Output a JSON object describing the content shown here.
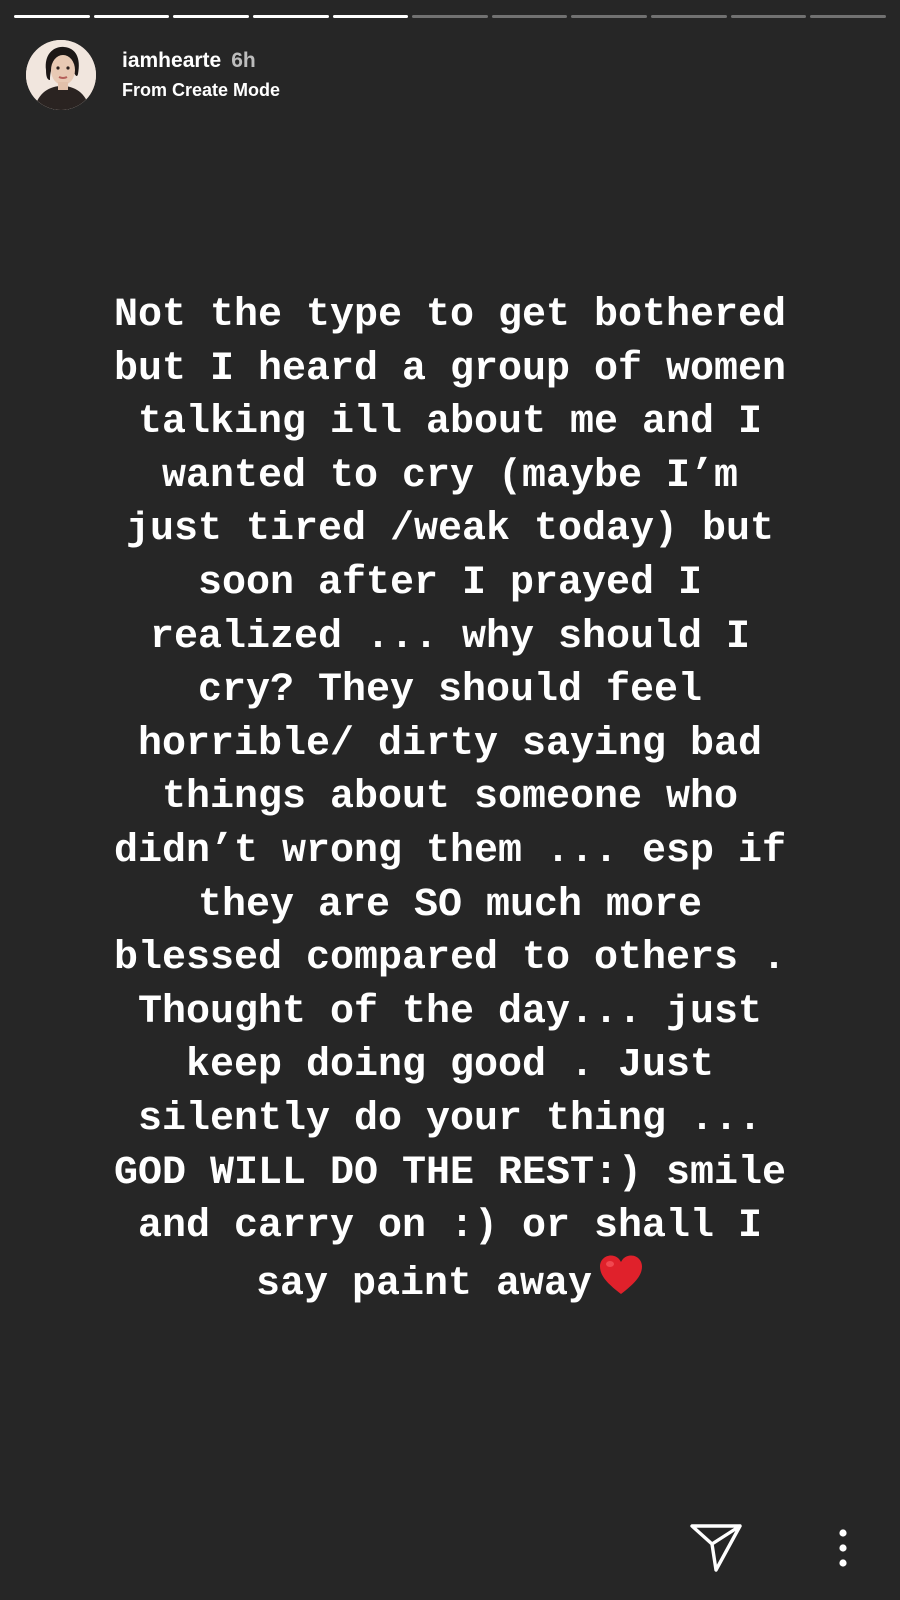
{
  "progress": {
    "total_segments": 11,
    "completed_segments": 5
  },
  "header": {
    "username": "iamhearte",
    "time": "6h",
    "subtitle": "From Create Mode"
  },
  "story": {
    "lines": [
      "Not the type to get bothered",
      "but I heard a group of women",
      "talking ill about me and I",
      "wanted to cry (maybe I’m",
      "just tired /weak today) but",
      "soon after I prayed I",
      "realized ... why should I",
      "cry? They should feel",
      "horrible/ dirty saying bad",
      "things about someone who",
      "didn’t wrong them ... esp if",
      "they are SO much more",
      "blessed compared to others .",
      "Thought of the day... just",
      "keep doing good . Just",
      "silently do your thing ...",
      "GOD WILL DO THE REST:) smile",
      "and carry on :) or shall I",
      "say paint away"
    ],
    "emoji": "red-heart-icon"
  },
  "actions": {
    "send_icon": "send-direct-icon",
    "more_icon": "more-vertical-icon"
  },
  "colors": {
    "background": "#262626",
    "text": "#ffffff",
    "muted": "#bdbdbd",
    "heart": "#e0212b"
  }
}
